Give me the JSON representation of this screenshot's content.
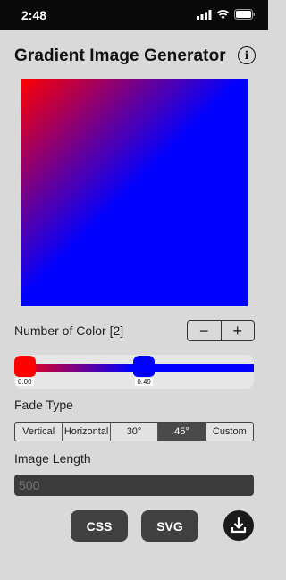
{
  "status": {
    "time": "2:48"
  },
  "header": {
    "title": "Gradient Image Generator",
    "info_glyph": "i"
  },
  "preview": {
    "start_color": "#ff0000",
    "end_color": "#0000ff",
    "angle_deg": 45
  },
  "colors": {
    "label": "Number of Color [2]",
    "minus": "−",
    "plus": "+",
    "stops": [
      {
        "position": 0.0,
        "label": "0.00",
        "color": "#ff0000"
      },
      {
        "position": 0.49,
        "label": "0.49",
        "color": "#0000ff"
      }
    ]
  },
  "fade": {
    "label": "Fade Type",
    "options": [
      "Vertical",
      "Horizontal",
      "30°",
      "45°",
      "Custom"
    ],
    "selected": "45°"
  },
  "length": {
    "label": "Image Length",
    "placeholder": "500"
  },
  "actions": {
    "css_label": "CSS",
    "svg_label": "SVG",
    "download_icon": "download-icon"
  }
}
